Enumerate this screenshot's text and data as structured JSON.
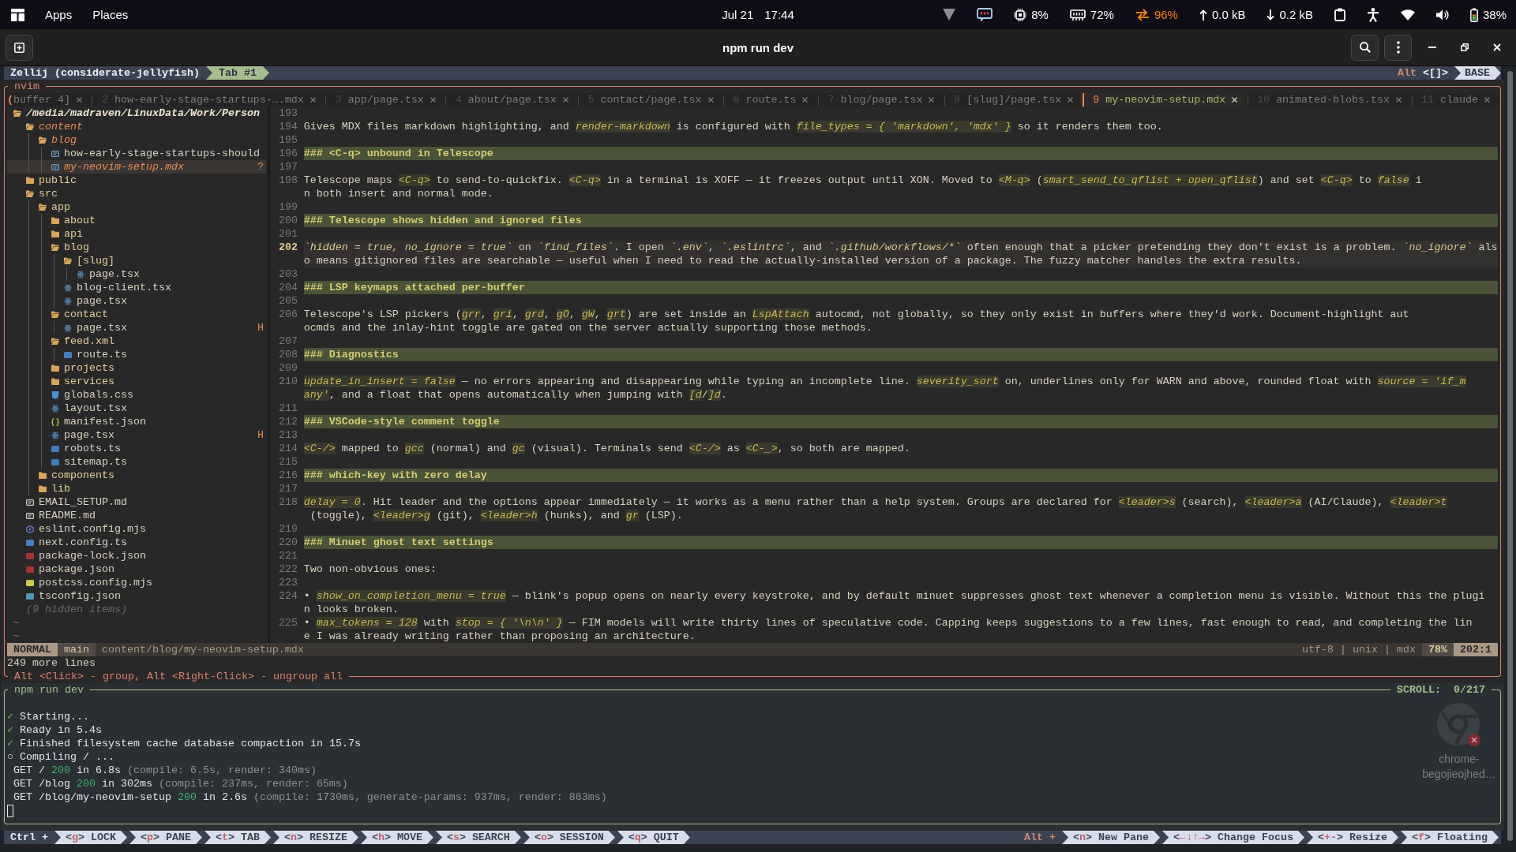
{
  "top_bar": {
    "menus": [
      "Apps",
      "Places"
    ],
    "date": "Jul 21",
    "time": "17:44",
    "indicators": [
      {
        "kind": "vpn",
        "alert": false
      },
      {
        "kind": "chat",
        "alert": false
      },
      {
        "kind": "cpu",
        "value": "8%",
        "alert": false
      },
      {
        "kind": "memory",
        "value": "72%",
        "alert": false
      },
      {
        "kind": "swap",
        "value": "96%",
        "alert": true
      },
      {
        "kind": "upload",
        "value": "0.0 kB",
        "alert": false
      },
      {
        "kind": "download",
        "value": "0.2 kB",
        "alert": false
      },
      {
        "kind": "clipboard",
        "alert": false
      },
      {
        "kind": "accessibility",
        "alert": false
      },
      {
        "kind": "wifi",
        "alert": false
      },
      {
        "kind": "volume",
        "alert": false
      },
      {
        "kind": "battery",
        "value": "38%",
        "alert": false
      }
    ]
  },
  "window": {
    "title": "npm run dev"
  },
  "zellij_bar": {
    "session": "Zellij (considerate-jellyfish)",
    "tabs": [
      {
        "label": "Tab #1",
        "selected": true
      }
    ],
    "modifier": "Alt",
    "mode_keys": "<[]>",
    "mode": "BASE"
  },
  "editor_pane": {
    "title": "nvim",
    "footer": "Alt <Click> - group, Alt <Right-Click> - ungroup all"
  },
  "bufferline": {
    "overflow_marker": "(",
    "buffers": [
      {
        "name": "buffer 4]",
        "selected": false
      },
      {
        "number": "2",
        "name": "how-early-stage-startups-….mdx",
        "selected": false
      },
      {
        "number": "3",
        "name": "app/page.tsx",
        "selected": false
      },
      {
        "number": "4",
        "name": "about/page.tsx",
        "selected": false
      },
      {
        "number": "5",
        "name": "contact/page.tsx",
        "selected": false
      },
      {
        "number": "6",
        "name": "route.ts",
        "selected": false
      },
      {
        "number": "7",
        "name": "blog/page.tsx",
        "selected": false
      },
      {
        "number": "8",
        "name": "[slug]/page.tsx",
        "selected": false
      },
      {
        "number": "9",
        "name": "my-neovim-setup.mdx",
        "selected": true
      },
      {
        "number": "10",
        "name": "animated-blobs.tsx",
        "selected": false
      },
      {
        "number": "11",
        "name": "claude",
        "selected": false
      }
    ]
  },
  "file_tree": {
    "root": "/media/madraven/LinuxData/Work/Person",
    "items": [
      {
        "name": "content",
        "kind": "folder",
        "expanded": true,
        "modified": true,
        "selected": false,
        "children": [
          {
            "name": "blog",
            "kind": "folder",
            "expanded": true,
            "modified": true,
            "selected": false,
            "children": [
              {
                "name": "how-early-stage-startups-should",
                "kind": "mdx",
                "modified": false,
                "selected": false
              },
              {
                "name": "my-neovim-setup.mdx",
                "kind": "mdx",
                "modified": true,
                "selected": true,
                "status": "?"
              }
            ]
          }
        ]
      },
      {
        "name": "public",
        "kind": "folder",
        "expanded": false,
        "modified": false,
        "selected": false
      },
      {
        "name": "src",
        "kind": "folder",
        "expanded": true,
        "modified": false,
        "selected": false,
        "children": [
          {
            "name": "app",
            "kind": "folder",
            "expanded": true,
            "modified": false,
            "selected": false,
            "children": [
              {
                "name": "about",
                "kind": "folder",
                "expanded": false,
                "modified": false,
                "selected": false
              },
              {
                "name": "api",
                "kind": "folder",
                "expanded": false,
                "modified": false,
                "selected": false
              },
              {
                "name": "blog",
                "kind": "folder",
                "expanded": true,
                "modified": false,
                "selected": false,
                "children": [
                  {
                    "name": "[slug]",
                    "kind": "folder",
                    "expanded": true,
                    "modified": false,
                    "selected": false,
                    "children": [
                      {
                        "name": "page.tsx",
                        "kind": "tsx",
                        "modified": false,
                        "selected": false
                      }
                    ]
                  },
                  {
                    "name": "blog-client.tsx",
                    "kind": "tsx",
                    "modified": false,
                    "selected": false
                  },
                  {
                    "name": "page.tsx",
                    "kind": "tsx",
                    "modified": false,
                    "selected": false
                  }
                ]
              },
              {
                "name": "contact",
                "kind": "folder",
                "expanded": true,
                "modified": false,
                "selected": false,
                "children": [
                  {
                    "name": "page.tsx",
                    "kind": "tsx",
                    "modified": false,
                    "selected": false,
                    "status": "H"
                  }
                ]
              },
              {
                "name": "feed.xml",
                "kind": "folder",
                "expanded": true,
                "modified": false,
                "selected": false,
                "children": [
                  {
                    "name": "route.ts",
                    "kind": "ts",
                    "modified": false,
                    "selected": false
                  }
                ]
              },
              {
                "name": "projects",
                "kind": "folder",
                "expanded": false,
                "modified": false,
                "selected": false
              },
              {
                "name": "services",
                "kind": "folder",
                "expanded": false,
                "modified": false,
                "selected": false
              },
              {
                "name": "globals.css",
                "kind": "css",
                "modified": false,
                "selected": false
              },
              {
                "name": "layout.tsx",
                "kind": "tsx",
                "modified": false,
                "selected": false
              },
              {
                "name": "manifest.json",
                "kind": "json",
                "modified": false,
                "selected": false
              },
              {
                "name": "page.tsx",
                "kind": "tsx",
                "modified": false,
                "selected": false,
                "status": "H"
              },
              {
                "name": "robots.ts",
                "kind": "ts",
                "modified": false,
                "selected": false
              },
              {
                "name": "sitemap.ts",
                "kind": "ts",
                "modified": false,
                "selected": false
              }
            ]
          },
          {
            "name": "components",
            "kind": "folder",
            "expanded": false,
            "modified": false,
            "selected": false
          },
          {
            "name": "lib",
            "kind": "folder",
            "expanded": false,
            "modified": false,
            "selected": false
          }
        ]
      },
      {
        "name": "EMAIL_SETUP.md",
        "kind": "md",
        "modified": false,
        "selected": false
      },
      {
        "name": "README.md",
        "kind": "md",
        "modified": false,
        "selected": false
      },
      {
        "name": "eslint.config.mjs",
        "kind": "eslint",
        "modified": false,
        "selected": false
      },
      {
        "name": "next.config.ts",
        "kind": "ts",
        "modified": false,
        "selected": false
      },
      {
        "name": "package-lock.json",
        "kind": "npm",
        "modified": false,
        "selected": false
      },
      {
        "name": "package.json",
        "kind": "npm",
        "modified": false,
        "selected": false
      },
      {
        "name": "postcss.config.mjs",
        "kind": "js",
        "modified": false,
        "selected": false
      },
      {
        "name": "tsconfig.json",
        "kind": "tsconfig",
        "modified": false,
        "selected": false
      }
    ],
    "hidden_note": "(9 hidden items)",
    "end_markers": [
      "~",
      "~"
    ]
  },
  "editor": {
    "lines": [
      {
        "number": "193",
        "kind": "blank",
        "current": false
      },
      {
        "number": "194",
        "kind": "para",
        "current": false,
        "display_lines": [
          {
            "spans": [
              {
                "text": "Gives MDX files markdown highlighting, and ",
                "kind": "plain"
              },
              {
                "text": "render-markdown",
                "kind": "code"
              },
              {
                "text": " is configured with ",
                "kind": "plain"
              },
              {
                "text": "file_types = { 'markdown', 'mdx' }",
                "kind": "code"
              },
              {
                "text": " so it renders them too.",
                "kind": "plain"
              }
            ]
          }
        ]
      },
      {
        "number": "195",
        "kind": "blank",
        "current": false
      },
      {
        "number": "196",
        "kind": "heading",
        "current": false,
        "text": "### <C-q> unbound in Telescope"
      },
      {
        "number": "197",
        "kind": "blank",
        "current": false
      },
      {
        "number": "198",
        "kind": "para",
        "current": false,
        "display_lines": [
          {
            "spans": [
              {
                "text": "Telescope maps ",
                "kind": "plain"
              },
              {
                "text": "<C-q>",
                "kind": "code"
              },
              {
                "text": " to send-to-quickfix. ",
                "kind": "plain"
              },
              {
                "text": "<C-q>",
                "kind": "code"
              },
              {
                "text": " in a terminal is XOFF — it freezes output until XON. Moved to ",
                "kind": "plain"
              },
              {
                "text": "<M-q>",
                "kind": "code"
              },
              {
                "text": " (",
                "kind": "plain"
              },
              {
                "text": "smart_send_to_qflist + open_qflist",
                "kind": "code"
              },
              {
                "text": ") and set ",
                "kind": "plain"
              },
              {
                "text": "<C-q>",
                "kind": "code"
              },
              {
                "text": " to ",
                "kind": "plain"
              },
              {
                "text": "false",
                "kind": "code"
              },
              {
                "text": " i",
                "kind": "plain"
              }
            ]
          },
          {
            "spans": [
              {
                "text": "n both insert and normal mode.",
                "kind": "plain"
              }
            ]
          }
        ]
      },
      {
        "number": "199",
        "kind": "blank",
        "current": false
      },
      {
        "number": "200",
        "kind": "heading",
        "current": false,
        "text": "### Telescope shows hidden and ignored files"
      },
      {
        "number": "201",
        "kind": "blank",
        "current": false
      },
      {
        "number": "202",
        "kind": "para",
        "current": true,
        "display_lines": [
          {
            "spans": [
              {
                "text": "`hidden = true, no_ignore = true`",
                "kind": "code"
              },
              {
                "text": " on ",
                "kind": "plain"
              },
              {
                "text": "`find_files`",
                "kind": "code"
              },
              {
                "text": ". I open ",
                "kind": "plain"
              },
              {
                "text": "`.env`",
                "kind": "code"
              },
              {
                "text": ", ",
                "kind": "plain"
              },
              {
                "text": "`.eslintrc`",
                "kind": "code"
              },
              {
                "text": ", and ",
                "kind": "plain"
              },
              {
                "text": "`.github/workflows/*`",
                "kind": "code"
              },
              {
                "text": " often enough that a picker pretending they don't exist is a problem. ",
                "kind": "plain"
              },
              {
                "text": "`no_ignore`",
                "kind": "code"
              },
              {
                "text": " als",
                "kind": "plain"
              }
            ]
          },
          {
            "spans": [
              {
                "text": "o means gitignored files are searchable — useful when I need to read the actually-installed version of a package. The fuzzy matcher handles the extra results.",
                "kind": "plain"
              }
            ]
          }
        ]
      },
      {
        "number": "203",
        "kind": "blank",
        "current": false
      },
      {
        "number": "204",
        "kind": "heading",
        "current": false,
        "text": "### LSP keymaps attached per-buffer"
      },
      {
        "number": "205",
        "kind": "blank",
        "current": false
      },
      {
        "number": "206",
        "kind": "para",
        "current": false,
        "display_lines": [
          {
            "spans": [
              {
                "text": "Telescope's LSP pickers (",
                "kind": "plain"
              },
              {
                "text": "grr",
                "kind": "code"
              },
              {
                "text": ", ",
                "kind": "plain"
              },
              {
                "text": "gri",
                "kind": "code"
              },
              {
                "text": ", ",
                "kind": "plain"
              },
              {
                "text": "grd",
                "kind": "code"
              },
              {
                "text": ", ",
                "kind": "plain"
              },
              {
                "text": "gO",
                "kind": "code"
              },
              {
                "text": ", ",
                "kind": "plain"
              },
              {
                "text": "gW",
                "kind": "code"
              },
              {
                "text": ", ",
                "kind": "plain"
              },
              {
                "text": "grt",
                "kind": "code"
              },
              {
                "text": ") are set inside an ",
                "kind": "plain"
              },
              {
                "text": "LspAttach",
                "kind": "code"
              },
              {
                "text": " autocmd, not globally, so they only exist in buffers where they'd work. Document-highlight aut",
                "kind": "plain"
              }
            ]
          },
          {
            "spans": [
              {
                "text": "ocmds and the inlay-hint toggle are gated on the server actually supporting those methods.",
                "kind": "plain"
              }
            ]
          }
        ]
      },
      {
        "number": "207",
        "kind": "blank",
        "current": false
      },
      {
        "number": "208",
        "kind": "heading",
        "current": false,
        "text": "### Diagnostics"
      },
      {
        "number": "209",
        "kind": "blank",
        "current": false
      },
      {
        "number": "210",
        "kind": "para",
        "current": false,
        "display_lines": [
          {
            "spans": [
              {
                "text": "update_in_insert = false",
                "kind": "code"
              },
              {
                "text": " — no errors appearing and disappearing while typing an incomplete line. ",
                "kind": "plain"
              },
              {
                "text": "severity_sort",
                "kind": "code"
              },
              {
                "text": " on, underlines only for WARN and above, rounded float with ",
                "kind": "plain"
              },
              {
                "text": "source = 'if_m",
                "kind": "code"
              }
            ]
          },
          {
            "spans": [
              {
                "text": "any'",
                "kind": "code"
              },
              {
                "text": ", and a float that opens automatically when jumping with ",
                "kind": "plain"
              },
              {
                "text": "[d",
                "kind": "code"
              },
              {
                "text": "/",
                "kind": "plain"
              },
              {
                "text": "]d",
                "kind": "code"
              },
              {
                "text": ".",
                "kind": "plain"
              }
            ]
          }
        ]
      },
      {
        "number": "211",
        "kind": "blank",
        "current": false
      },
      {
        "number": "212",
        "kind": "heading",
        "current": false,
        "text": "### VSCode-style comment toggle"
      },
      {
        "number": "213",
        "kind": "blank",
        "current": false
      },
      {
        "number": "214",
        "kind": "para",
        "current": false,
        "display_lines": [
          {
            "spans": [
              {
                "text": "<C-/>",
                "kind": "code"
              },
              {
                "text": " mapped to ",
                "kind": "plain"
              },
              {
                "text": "gcc",
                "kind": "code"
              },
              {
                "text": " (normal) and ",
                "kind": "plain"
              },
              {
                "text": "gc",
                "kind": "code"
              },
              {
                "text": " (visual). Terminals send ",
                "kind": "plain"
              },
              {
                "text": "<C-/>",
                "kind": "code"
              },
              {
                "text": " as ",
                "kind": "plain"
              },
              {
                "text": "<C-_>",
                "kind": "code"
              },
              {
                "text": ", so both are mapped.",
                "kind": "plain"
              }
            ]
          }
        ]
      },
      {
        "number": "215",
        "kind": "blank",
        "current": false
      },
      {
        "number": "216",
        "kind": "heading",
        "current": false,
        "text": "### which-key with zero delay"
      },
      {
        "number": "217",
        "kind": "blank",
        "current": false
      },
      {
        "number": "218",
        "kind": "para",
        "current": false,
        "display_lines": [
          {
            "spans": [
              {
                "text": "delay = 0",
                "kind": "code"
              },
              {
                "text": ". Hit leader and the options appear immediately — it works as a menu rather than a help system. Groups are declared for ",
                "kind": "plain"
              },
              {
                "text": "<leader>s",
                "kind": "code"
              },
              {
                "text": " (search), ",
                "kind": "plain"
              },
              {
                "text": "<leader>a",
                "kind": "code"
              },
              {
                "text": " (AI/Claude), ",
                "kind": "plain"
              },
              {
                "text": "<leader>t",
                "kind": "code"
              }
            ]
          },
          {
            "spans": [
              {
                "text": " (toggle), ",
                "kind": "plain"
              },
              {
                "text": "<leader>g",
                "kind": "code"
              },
              {
                "text": " (git), ",
                "kind": "plain"
              },
              {
                "text": "<leader>h",
                "kind": "code"
              },
              {
                "text": " (hunks), and ",
                "kind": "plain"
              },
              {
                "text": "gr",
                "kind": "code"
              },
              {
                "text": " (LSP).",
                "kind": "plain"
              }
            ]
          }
        ]
      },
      {
        "number": "219",
        "kind": "blank",
        "current": false
      },
      {
        "number": "220",
        "kind": "heading",
        "current": false,
        "text": "### Minuet ghost text settings"
      },
      {
        "number": "221",
        "kind": "blank",
        "current": false
      },
      {
        "number": "222",
        "kind": "para",
        "current": false,
        "display_lines": [
          {
            "spans": [
              {
                "text": "Two non-obvious ones:",
                "kind": "plain"
              }
            ]
          }
        ]
      },
      {
        "number": "223",
        "kind": "blank",
        "current": false
      },
      {
        "number": "224",
        "kind": "para",
        "current": false,
        "display_lines": [
          {
            "spans": [
              {
                "text": "• ",
                "kind": "plain"
              },
              {
                "text": "show_on_completion_menu = true",
                "kind": "code"
              },
              {
                "text": " — blink's popup opens on nearly every keystroke, and by default minuet suppresses ghost text whenever a completion menu is visible. Without this the plugi",
                "kind": "plain"
              }
            ]
          },
          {
            "spans": [
              {
                "text": "n looks broken.",
                "kind": "plain"
              }
            ]
          }
        ]
      },
      {
        "number": "225",
        "kind": "para",
        "current": false,
        "display_lines": [
          {
            "spans": [
              {
                "text": "• ",
                "kind": "plain"
              },
              {
                "text": "max_tokens = 128",
                "kind": "code"
              },
              {
                "text": " with ",
                "kind": "plain"
              },
              {
                "text": "stop = { '\\n\\n' }",
                "kind": "code"
              },
              {
                "text": " — FIM models will write thirty lines of speculative code. Capping keeps suggestions to a few lines, fast enough to read, and completing the lin",
                "kind": "plain"
              }
            ]
          },
          {
            "spans": [
              {
                "text": "e I was already writing rather than proposing an architecture.",
                "kind": "plain"
              }
            ]
          }
        ]
      }
    ]
  },
  "statusline": {
    "mode": "NORMAL",
    "branch": "main",
    "file": "content/blog/my-neovim-setup.mdx",
    "file_info": "utf-8 | unix | mdx",
    "progress": "78%",
    "position": "202:1"
  },
  "command_line": "249 more lines",
  "terminal_pane": {
    "title": "npm run dev",
    "scroll": "SCROLL:  0/217",
    "output": [
      {
        "kind": "ok",
        "mark": "✓",
        "text": "Starting..."
      },
      {
        "kind": "ok",
        "mark": "✓",
        "text": "Ready in 5.4s"
      },
      {
        "kind": "ok",
        "mark": "✓",
        "text": "Finished filesystem cache database compaction in 15.7s"
      },
      {
        "kind": "pending",
        "mark": "○",
        "text": "Compiling / ..."
      },
      {
        "kind": "request",
        "request": "GET /",
        "status": "200",
        "time": "in 6.8s",
        "detail": "(compile: 6.5s, render: 340ms)"
      },
      {
        "kind": "request",
        "request": "GET /blog",
        "status": "200",
        "time": "in 302ms",
        "detail": "(compile: 237ms, render: 65ms)"
      },
      {
        "kind": "request",
        "request": "GET /blog/my-neovim-setup",
        "status": "200",
        "time": "in 2.6s",
        "detail": "(compile: 1730ms, generate-params: 937ms, render: 863ms)"
      }
    ]
  },
  "desktop_icon": {
    "label": "chrome-begojieojhed…"
  },
  "status_bar": {
    "ctrl_label": "Ctrl +",
    "ctrl_hints": [
      {
        "key": "<g>",
        "label": "LOCK"
      },
      {
        "key": "<p>",
        "label": "PANE"
      },
      {
        "key": "<t>",
        "label": "TAB"
      },
      {
        "key": "<n>",
        "label": "RESIZE"
      },
      {
        "key": "<h>",
        "label": "MOVE"
      },
      {
        "key": "<s>",
        "label": "SEARCH"
      },
      {
        "key": "<o>",
        "label": "SESSION"
      },
      {
        "key": "<q>",
        "label": "QUIT"
      }
    ],
    "alt_label": "Alt +",
    "alt_hints": [
      {
        "key": "<n>",
        "label": "New Pane"
      },
      {
        "key": "<←↓↑→>",
        "label": "Change Focus"
      },
      {
        "key": "<+->",
        "label": "Resize"
      },
      {
        "key": "<f>",
        "label": "Floating"
      }
    ]
  }
}
